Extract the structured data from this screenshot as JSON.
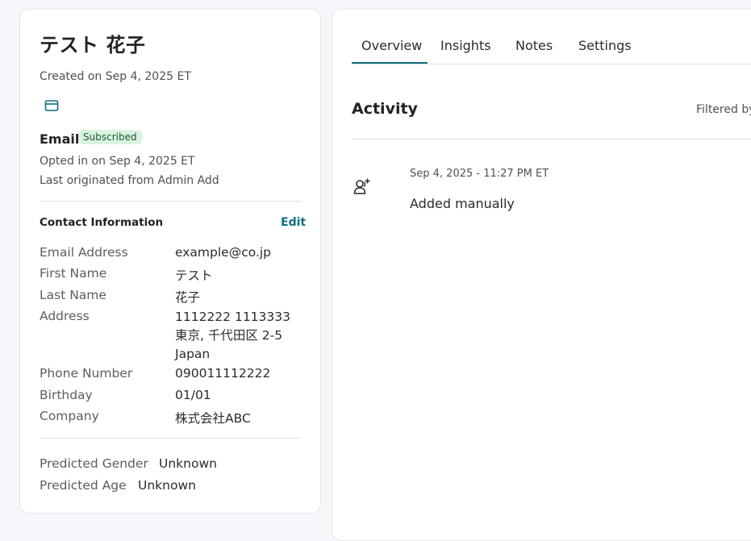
{
  "contact": {
    "name": "テスト 花子",
    "created": "Created on Sep 4, 2025 ET",
    "channel_icon": "mail-icon",
    "email_label": "Email",
    "email_status": "Subscribed",
    "opted_in": "Opted in on Sep 4, 2025 ET",
    "originated": "Last originated from Admin Add"
  },
  "contact_info": {
    "header": "Contact Information",
    "edit_label": "Edit",
    "fields": [
      {
        "label": "Email Address",
        "value": "example@co.jp"
      },
      {
        "label": "First Name",
        "value": "テスト"
      },
      {
        "label": "Last Name",
        "value": "花子"
      },
      {
        "label": "Address",
        "value": "1112222 1113333 東京, 千代田区 2-5 Japan"
      },
      {
        "label": "Phone Number",
        "value": "090011112222"
      },
      {
        "label": "Birthday",
        "value": "01/01"
      },
      {
        "label": "Company",
        "value": "株式会社ABC"
      }
    ]
  },
  "predictions": {
    "gender_label": "Predicted Gender",
    "gender_value": "Unknown",
    "age_label": "Predicted Age",
    "age_value": "Unknown"
  },
  "tabs": [
    {
      "label": "Overview",
      "active": true
    },
    {
      "label": "Insights"
    },
    {
      "label": "Notes"
    },
    {
      "label": "Settings"
    }
  ],
  "activity": {
    "title": "Activity",
    "filter_text": "Filtered by",
    "items": [
      {
        "icon": "user-plus-icon",
        "timestamp": "Sep 4, 2025 - 11:27 PM ET",
        "text": "Added manually"
      }
    ]
  },
  "colors": {
    "accent": "#0f6f7e",
    "badge_bg": "#d9f3e1",
    "badge_text": "#1e5a34"
  }
}
